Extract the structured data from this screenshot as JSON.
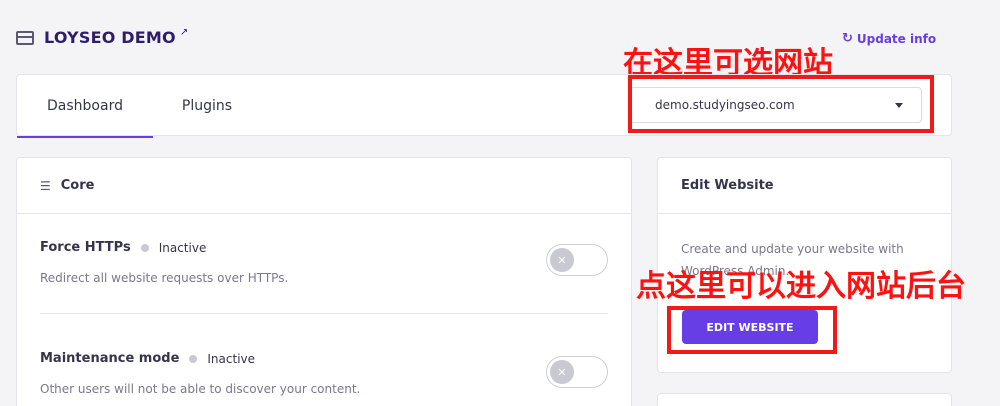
{
  "site": {
    "name": "LOYSEO DEMO",
    "external_icon": "external-link-icon",
    "site_icon": "browser-window-icon"
  },
  "header": {
    "update_info_label": "Update info",
    "update_icon": "refresh-icon"
  },
  "tabs": [
    {
      "label": "Dashboard",
      "active": true
    },
    {
      "label": "Plugins",
      "active": false
    }
  ],
  "site_select": {
    "value": "demo.studyingseo.com"
  },
  "annotations": {
    "select_site": "在这里可选网站",
    "enter_admin": "点这里可以进入网站后台",
    "color": "#ff1111"
  },
  "core": {
    "title": "Core",
    "icon": "layers-icon",
    "settings": [
      {
        "name": "Force HTTPs",
        "status": "Inactive",
        "description": "Redirect all website requests over HTTPs."
      },
      {
        "name": "Maintenance mode",
        "status": "Inactive",
        "description": "Other users will not be able to discover your content."
      }
    ]
  },
  "edit_website": {
    "title": "Edit Website",
    "description": "Create and update your website with WordPress Admin.",
    "button_label": "EDIT WEBSITE"
  },
  "colors": {
    "accent": "#673de6",
    "highlight_box": "#f01a1a"
  }
}
